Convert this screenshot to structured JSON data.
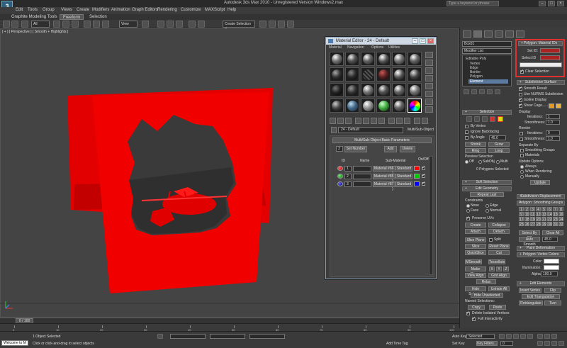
{
  "window": {
    "title": "Autodesk 3ds Max 2010 - Unregistered Version   Windows2.max",
    "search_placeholder": "Type a keyword or phrase",
    "app_icon": "3ds-max-icon"
  },
  "menu": {
    "items": [
      "Edit",
      "Tools",
      "Group",
      "Views",
      "Create",
      "Modifiers",
      "Animation",
      "Graph Editors",
      "Rendering",
      "Customize",
      "MAXScript",
      "Help"
    ]
  },
  "toolbar": {
    "selection_filter": "All",
    "view_dropdown": "View",
    "named_selection": "Create Selection Se"
  },
  "ribbon": {
    "title": "Graphite Modeling Tools",
    "tabs": [
      "Freeform",
      "Selection"
    ]
  },
  "viewport": {
    "label": "[ + ] [ Perspective ] [ Smooth + Highlights ]",
    "background": "#444444",
    "object_color": "#ff0000"
  },
  "material_editor": {
    "title": "Material Editor - 24 - Default",
    "menu": [
      "Material",
      "Navigation",
      "Options",
      "Utilities"
    ],
    "material_name": "24 - Default",
    "material_type": "Multi/Sub-Object",
    "rollout_title": "Multi/Sub-Object Basic Parameters",
    "count": "3",
    "set_number_label": "Set Number",
    "add_label": "Add",
    "delete_label": "Delete",
    "col_id": "ID",
    "col_name": "Name",
    "col_submat": "Sub-Material",
    "col_onoff": "On/Off",
    "rows": [
      {
        "id": "1",
        "sub": "Material #66  ( Standard )",
        "color": "#ff0000"
      },
      {
        "id": "2",
        "sub": "Material #85  ( Standard )",
        "color": "#00cc00"
      },
      {
        "id": "3",
        "sub": "Material #87  ( Standard )",
        "color": "#0000ff"
      }
    ]
  },
  "command_panel": {
    "object_name": "Box01",
    "modifier_list": "Modifier List",
    "stack": {
      "root": "Editable Poly",
      "subitems": [
        "Vertex",
        "Edge",
        "Border",
        "Polygon",
        "Element"
      ],
      "selected": "Element"
    },
    "selection": {
      "title": "Selection",
      "by_vertex": "By Vertex",
      "ignore_backfacing": "Ignore Backfacing",
      "by_angle": "By Angle",
      "by_angle_value": "45.0",
      "shrink": "Shrink",
      "grow": "Grow",
      "ring": "Ring",
      "loop": "Loop",
      "preview_selection": "Preview Selection",
      "preview_options": [
        "Off",
        "SubObj",
        "Multi"
      ],
      "status": "0 Polygons Selected"
    },
    "soft_selection": "Soft Selection",
    "edit_geometry": {
      "title": "Edit Geometry",
      "repeat_last": "Repeat Last",
      "constraints": "Constraints",
      "constraint_options": [
        "None",
        "Edge",
        "Face",
        "Normal"
      ],
      "preserve_uvs": "Preserve UVs",
      "create": "Create",
      "collapse": "Collapse",
      "attach": "Attach",
      "detach": "Detach",
      "slice_plane": "Slice Plane",
      "split": "Split",
      "slice": "Slice",
      "reset_plane": "Reset Plane",
      "quickslice": "QuickSlice",
      "cut": "Cut",
      "msmooth": "MSmooth",
      "tessellate": "Tessellate",
      "make_planar": "Make Planar",
      "axes": [
        "X",
        "Y",
        "Z"
      ],
      "view_align": "View Align",
      "grid_align": "Grid Align",
      "relax": "Relax",
      "hide_selected": "Hide Selected",
      "unhide_all": "Unhide All",
      "hide_unselected": "Hide Unselected",
      "named_selections": "Named Selections:",
      "copy": "Copy",
      "paste": "Paste",
      "delete_isolated": "Delete Isolated Vertices",
      "full_interactivity": "Full Interactivity"
    },
    "material_ids": {
      "title": "Polygon: Material IDs",
      "set_id": "Set ID:",
      "select_id": "Select ID",
      "clear_selection": "Clear Selection"
    },
    "subdivision": {
      "title": "Subdivision Surface",
      "smooth_result": "Smooth Result",
      "use_nurms": "Use NURMS Subdivision",
      "isoline_display": "Isoline Display",
      "show_cage": "Show Cage......",
      "display": "Display",
      "iterations": "Iterations:",
      "iterations_value": "1",
      "smoothness": "Smoothness:",
      "smoothness_value": "1.0",
      "render": "Render",
      "render_iterations_value": "0",
      "render_smoothness_value": "1.0",
      "separate_by": "Separate By",
      "smoothing_groups": "Smoothing Groups",
      "materials": "Materials",
      "update_options": "Update Options",
      "always": "Always",
      "when_rendering": "When Rendering",
      "manually": "Manually",
      "update": "Update"
    },
    "subdiv_displacement": "Subdivision Displacement",
    "smoothing_groups": {
      "title": "Polygon: Smoothing Groups",
      "numbers": [
        "1",
        "2",
        "3",
        "4",
        "5",
        "6",
        "7",
        "8",
        "9",
        "10",
        "11",
        "12",
        "13",
        "14",
        "15",
        "16",
        "17",
        "18",
        "19",
        "20",
        "21",
        "22",
        "23",
        "24",
        "25",
        "26",
        "27",
        "28",
        "29",
        "30",
        "31",
        "32"
      ],
      "select_by_sg": "Select By SG",
      "clear_all": "Clear All",
      "auto_smooth": "Auto Smooth",
      "auto_smooth_value": "45.0"
    },
    "paint_deformation": "Paint Deformation",
    "vertex_colors": {
      "title": "Polygon: Vertex Colors",
      "color": "Color:",
      "illumination": "Illumination:",
      "alpha": "Alpha:",
      "alpha_value": "100.0"
    },
    "edit_elements": {
      "title": "Edit Elements",
      "insert_vertex": "Insert Vertex",
      "flip": "Flip",
      "edit_triangulation": "Edit Triangulation",
      "retriangulate": "Retriangulate",
      "turn": "Turn"
    }
  },
  "timeline": {
    "frame_label": "0 / 100",
    "ticks": [
      "0",
      "10",
      "20",
      "30",
      "40",
      "50",
      "60",
      "70",
      "80",
      "90",
      "100"
    ]
  },
  "status": {
    "maxscript": "Welcome to M",
    "selected": "1 Object Selected",
    "prompt": "Click or click-and-drag to select objects",
    "add_time_tag": "Add Time Tag",
    "auto_key": "Auto Key",
    "set_key": "Set Key",
    "key_mode": "Selected",
    "key_filters": "Key Filters...",
    "frame": "0"
  }
}
